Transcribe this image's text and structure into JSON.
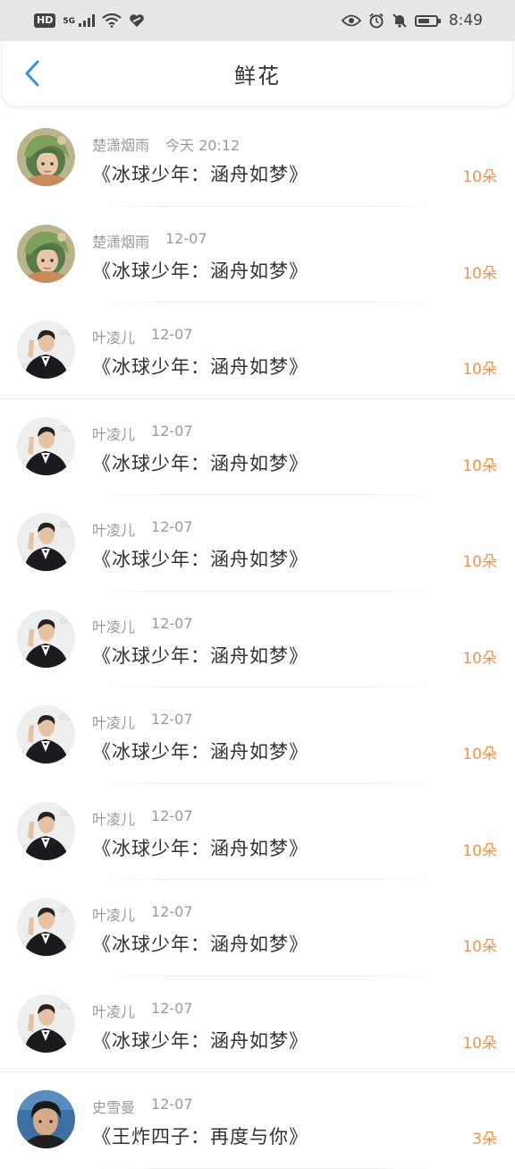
{
  "status_bar": {
    "hd": "HD",
    "network": "5G",
    "time": "8:49",
    "battery_level": 0.7
  },
  "header": {
    "title": "鲜花",
    "back_icon": "chevron-left-icon",
    "accent_color": "#3a8ee6"
  },
  "items": [
    {
      "user": "楚潇烟雨",
      "date": "今天 20:12",
      "work": "《冰球少年：涵舟如梦》",
      "flowers": "10朵",
      "avatar": "anime-girl"
    },
    {
      "user": "楚潇烟雨",
      "date": "12-07",
      "work": "《冰球少年：涵舟如梦》",
      "flowers": "10朵",
      "avatar": "anime-girl"
    },
    {
      "user": "叶凌儿",
      "date": "12-07",
      "work": "《冰球少年：涵舟如梦》",
      "flowers": "10朵",
      "avatar": "man-in-suit"
    },
    {
      "user": "叶凌儿",
      "date": "12-07",
      "work": "《冰球少年：涵舟如梦》",
      "flowers": "10朵",
      "avatar": "man-in-suit"
    },
    {
      "user": "叶凌儿",
      "date": "12-07",
      "work": "《冰球少年：涵舟如梦》",
      "flowers": "10朵",
      "avatar": "man-in-suit"
    },
    {
      "user": "叶凌儿",
      "date": "12-07",
      "work": "《冰球少年：涵舟如梦》",
      "flowers": "10朵",
      "avatar": "man-in-suit"
    },
    {
      "user": "叶凌儿",
      "date": "12-07",
      "work": "《冰球少年：涵舟如梦》",
      "flowers": "10朵",
      "avatar": "man-in-suit"
    },
    {
      "user": "叶凌儿",
      "date": "12-07",
      "work": "《冰球少年：涵舟如梦》",
      "flowers": "10朵",
      "avatar": "man-in-suit"
    },
    {
      "user": "叶凌儿",
      "date": "12-07",
      "work": "《冰球少年：涵舟如梦》",
      "flowers": "10朵",
      "avatar": "man-in-suit"
    },
    {
      "user": "叶凌儿",
      "date": "12-07",
      "work": "《冰球少年：涵舟如梦》",
      "flowers": "10朵",
      "avatar": "man-in-suit"
    },
    {
      "user": "史雪曼",
      "date": "12-07",
      "work": "《王炸四子：再度与你》",
      "flowers": "3朵",
      "avatar": "young-man"
    }
  ],
  "colors": {
    "flower_count": "#f0944d",
    "meta_text": "#9a9a9a",
    "status_bar_bg": "#e7e7e7"
  }
}
